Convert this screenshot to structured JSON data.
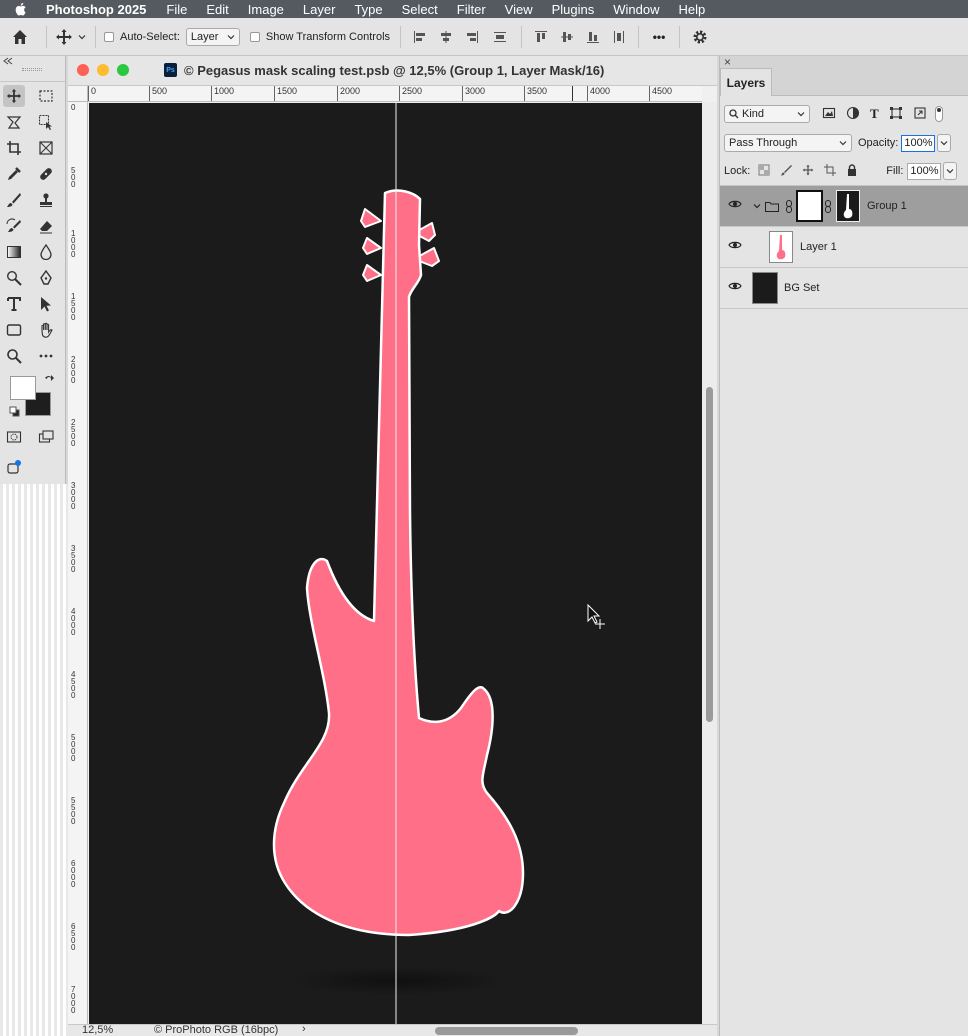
{
  "menubar": {
    "app_name": "Photoshop 2025",
    "menus": [
      "File",
      "Edit",
      "Image",
      "Layer",
      "Type",
      "Select",
      "Filter",
      "View",
      "Plugins",
      "Window",
      "Help"
    ]
  },
  "options_bar": {
    "auto_select_label": "Auto-Select:",
    "auto_select_value": "Layer",
    "show_transform_label": "Show Transform Controls",
    "more_label": "•••"
  },
  "document": {
    "title": "© Pegasus mask scaling test.psb @ 12,5% (Group 1, Layer Mask/16)",
    "ps_badge": "Ps",
    "zoom": "12,5%",
    "color_profile": "© ProPhoto RGB (16bpc)",
    "status_arrow": "›",
    "ruler_h": [
      "0",
      "500",
      "1000",
      "1500",
      "2000",
      "2500",
      "3000",
      "3500",
      "4000",
      "4500"
    ],
    "ruler_v": [
      "0",
      "5\n0\n0",
      "1\n0\n0\n0",
      "1\n5\n0\n0",
      "2\n0\n0\n0",
      "2\n5\n0\n0",
      "3\n0\n0\n0",
      "3\n5\n0\n0",
      "4\n0\n0\n0",
      "4\n5\n0\n0",
      "5\n0\n0\n0",
      "5\n5\n0\n0",
      "6\n0\n0\n0",
      "6\n5\n0\n0",
      "7\n0\n0\n0"
    ]
  },
  "layers_panel": {
    "tab_label": "Layers",
    "close_glyph": "×",
    "filter_kind": "Kind",
    "blend_mode": "Pass Through",
    "opacity_label": "Opacity:",
    "opacity_value": "100%",
    "lock_label": "Lock:",
    "fill_label": "Fill:",
    "fill_value": "100%",
    "layers": [
      {
        "name": "Group 1",
        "selected": true
      },
      {
        "name": "Layer 1",
        "selected": false
      },
      {
        "name": "BG Set",
        "selected": false
      }
    ]
  },
  "colors": {
    "guitar": "#ff6f87",
    "canvas_bg": "#1b1b1b",
    "menubar_bg": "#555a60"
  }
}
